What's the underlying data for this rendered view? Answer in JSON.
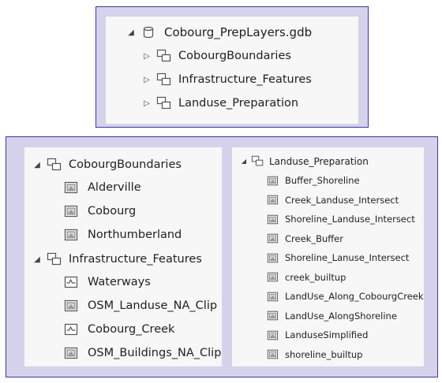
{
  "top_panel": {
    "geodatabase": "Cobourg_PrepLayers.gdb",
    "datasets": [
      "CobourgBoundaries",
      "Infrastructure_Features",
      "Landuse_Preparation"
    ]
  },
  "left_panel": {
    "groups": [
      {
        "name": "CobourgBoundaries",
        "items": [
          {
            "label": "Alderville",
            "type": "polygon"
          },
          {
            "label": "Cobourg",
            "type": "polygon"
          },
          {
            "label": "Northumberland",
            "type": "polygon"
          }
        ]
      },
      {
        "name": "Infrastructure_Features",
        "items": [
          {
            "label": "Waterways",
            "type": "line"
          },
          {
            "label": "OSM_Landuse_NA_Clip",
            "type": "polygon"
          },
          {
            "label": "Cobourg_Creek",
            "type": "line"
          },
          {
            "label": "OSM_Buildings_NA_Clip",
            "type": "polygon"
          }
        ]
      }
    ]
  },
  "right_panel": {
    "group": "Landuse_Preparation",
    "items": [
      "Buffer_Shoreline",
      "Creek_Landuse_Intersect",
      "Shoreline_Landuse_Intersect",
      "Creek_Buffer",
      "Shoreline_Lanuse_Intersect",
      "creek_builtup",
      "LandUse_Along_CobourgCreek",
      "LandUse_AlongShoreline",
      "LanduseSimplified",
      "shoreline_builtup"
    ]
  }
}
